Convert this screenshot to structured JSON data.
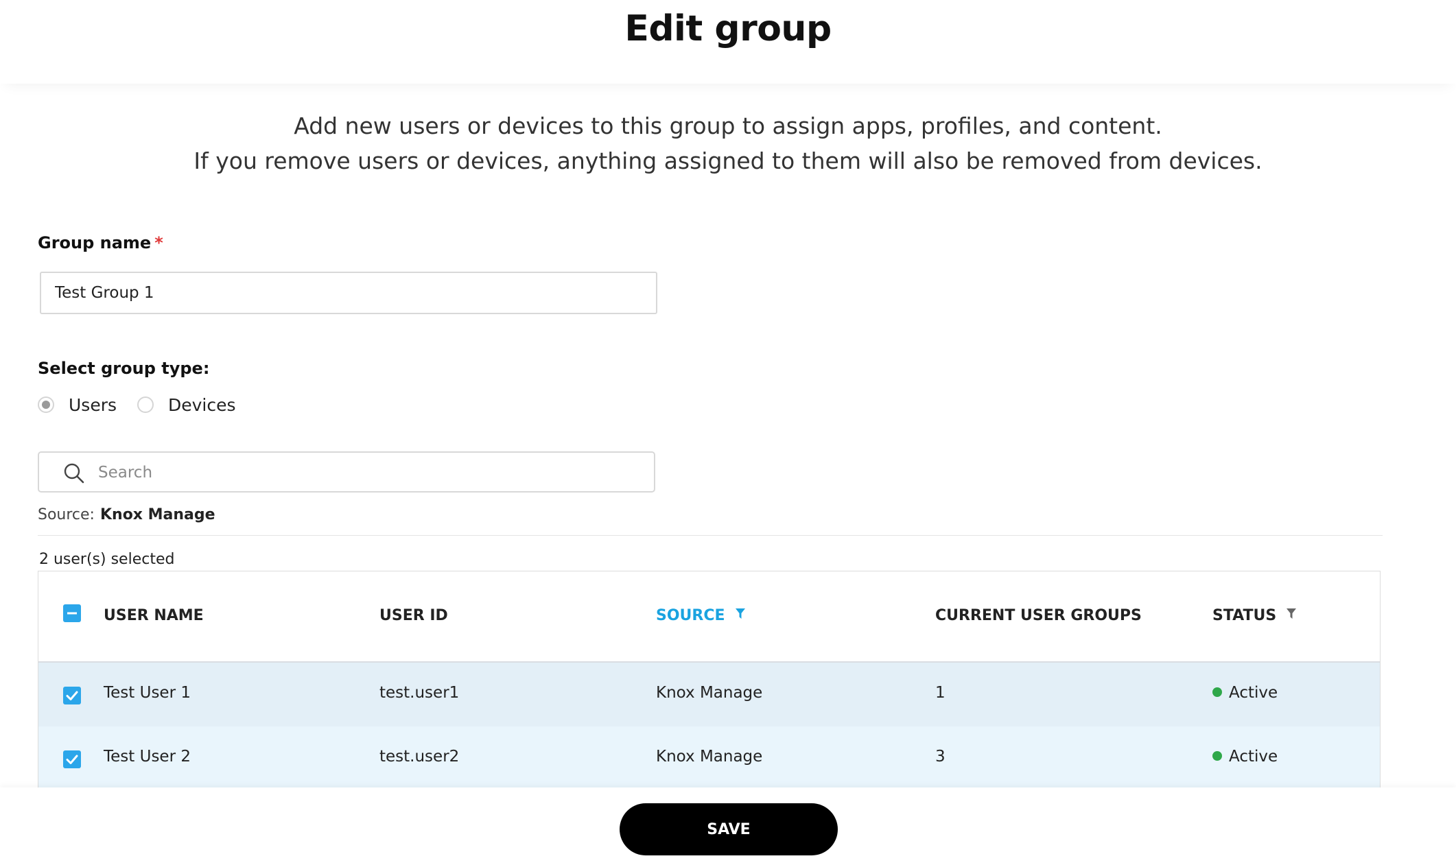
{
  "page": {
    "title": "Edit group",
    "description_line1": "Add new users or devices to this group to assign apps, profiles, and content.",
    "description_line2": "If you remove users or devices, anything assigned to them will also be removed from devices."
  },
  "form": {
    "group_name_label": "Group name",
    "required_mark": "*",
    "group_name_value": "Test Group 1",
    "group_type_label": "Select group type:",
    "group_type_options": [
      {
        "label": "Users",
        "selected": true
      },
      {
        "label": "Devices",
        "selected": false
      }
    ]
  },
  "search": {
    "placeholder": "Search",
    "icon": "search-icon"
  },
  "source": {
    "label": "Source:",
    "value": "Knox Manage"
  },
  "selection": {
    "count_text": "2 user(s) selected",
    "header_checkbox_state": "indeterminate"
  },
  "table": {
    "columns": [
      "USER NAME",
      "USER ID",
      "SOURCE",
      "CURRENT USER GROUPS",
      "STATUS"
    ],
    "filter_icon": "filter-icon",
    "rows": [
      {
        "selected": true,
        "user_name": "Test User 1",
        "user_id": "test.user1",
        "source": "Knox Manage",
        "groups": "1",
        "status": "Active"
      },
      {
        "selected": true,
        "user_name": "Test User 2",
        "user_id": "test.user2",
        "source": "Knox Manage",
        "groups": "3",
        "status": "Active"
      }
    ]
  },
  "footer": {
    "save_label": "SAVE"
  },
  "colors": {
    "accent": "#2ba6ea",
    "active_filter": "#1aa3e0",
    "status_active": "#2fa84a",
    "row_selected_1": "#e3eff7",
    "row_selected_2": "#e9f5fc",
    "required": "#e03a3a",
    "button": "#000000"
  }
}
